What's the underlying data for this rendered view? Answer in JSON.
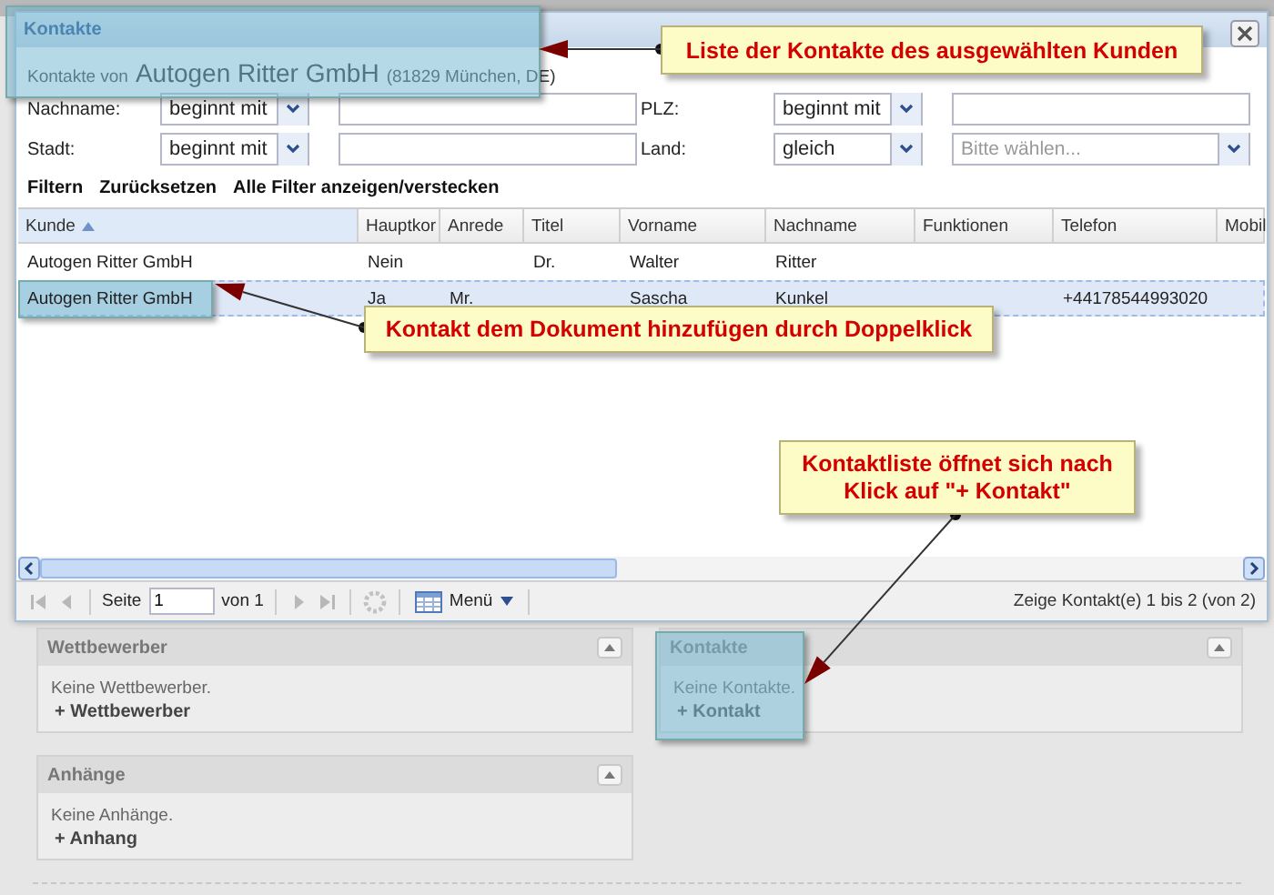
{
  "dialog": {
    "title": "Kontakte",
    "subtitle": {
      "prefix": "Kontakte von",
      "customer": "Autogen Ritter GmbH",
      "location": "(81829 München, DE)"
    },
    "filters": [
      {
        "kind": "text",
        "label": "Nachname:",
        "operator": "beginnt mit"
      },
      {
        "kind": "text",
        "label": "PLZ:",
        "operator": "beginnt mit"
      },
      {
        "kind": "text",
        "label": "Stadt:",
        "operator": "beginnt mit"
      },
      {
        "kind": "select",
        "label": "Land:",
        "operator": "gleich",
        "placeholder": "Bitte wählen..."
      }
    ],
    "filter_actions": [
      "Filtern",
      "Zurücksetzen",
      "Alle Filter anzeigen/verstecken"
    ],
    "table": {
      "columns": [
        {
          "label": "Kunde",
          "sorted": true
        },
        {
          "label": "Hauptkor",
          "sorted": false
        },
        {
          "label": "Anrede",
          "sorted": false
        },
        {
          "label": "Titel",
          "sorted": false
        },
        {
          "label": "Vorname",
          "sorted": false
        },
        {
          "label": "Nachname",
          "sorted": false
        },
        {
          "label": "Funktionen",
          "sorted": false
        },
        {
          "label": "Telefon",
          "sorted": false
        },
        {
          "label": "Mobil",
          "sorted": false
        }
      ],
      "rows": [
        {
          "selected": false,
          "cells": [
            "Autogen Ritter GmbH",
            "Nein",
            null,
            "Dr.",
            "Walter",
            "Ritter",
            null,
            null,
            null
          ]
        },
        {
          "selected": true,
          "cells": [
            "Autogen Ritter GmbH",
            "Ja",
            "Mr.",
            null,
            "Sascha",
            "Kunkel",
            null,
            "+44178544993020",
            null
          ]
        }
      ]
    },
    "pager": {
      "page_label": "Seite",
      "page": "1",
      "page_count": "von 1",
      "menu": "Menü",
      "summary": "Zeige Kontakt(e) 1 bis 2 (von 2)"
    }
  },
  "panels": [
    {
      "title": "Wettbewerber",
      "empty": "Keine Wettbewerber.",
      "action": "+ Wettbewerber"
    },
    {
      "title": "Kontakte",
      "empty": "Keine Kontakte.",
      "action": "+ Kontakt"
    },
    {
      "title": "Anhänge",
      "empty": "Keine Anhänge.",
      "action": "+ Anhang"
    }
  ],
  "callouts": [
    {
      "text": "Liste der Kontakte des ausgewählten Kunden"
    },
    {
      "text": "Kontakt dem Dokument hinzufügen durch Doppelklick"
    },
    {
      "text": "Kontaktliste öffnet sich nach Klick auf \"+ Kontakt\""
    }
  ]
}
